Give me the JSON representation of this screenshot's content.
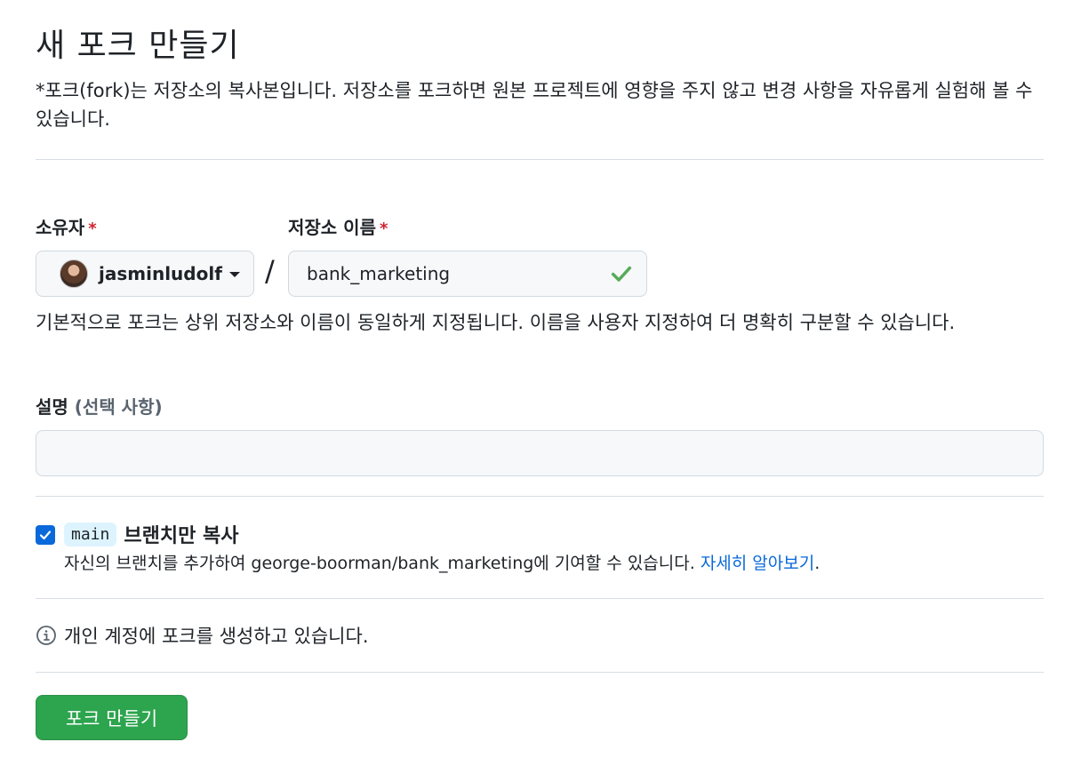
{
  "header": {
    "title": "새 포크 만들기",
    "subtitle": "*포크(fork)는 저장소의 복사본입니다. 저장소를 포크하면 원본 프로젝트에 영향을 주지 않고 변경 사항을 자유롭게 실험해 볼 수 있습니다."
  },
  "owner": {
    "label": "소유자",
    "required_mark": "*",
    "selected": "jasminludolf"
  },
  "separator": "/",
  "repo_name": {
    "label": "저장소 이름",
    "required_mark": "*",
    "value": "bank_marketing",
    "valid": true
  },
  "name_help": "기본적으로 포크는 상위 저장소와 이름이 동일하게 지정됩니다. 이름을 사용자 지정하여 더 명확히 구분할 수 있습니다.",
  "description": {
    "label": "설명",
    "optional_label": "(선택 사항)",
    "value": ""
  },
  "copy_branch": {
    "checked": true,
    "branch": "main",
    "label": "브랜치만 복사",
    "help_text": "자신의 브랜치를 추가하여 george-boorman/bank_marketing에 기여할 수 있습니다. ",
    "link_text": "자세히 알아보기",
    "link_suffix": "."
  },
  "info": {
    "icon": "info-icon",
    "text": "개인 계정에 포크를 생성하고 있습니다."
  },
  "submit": {
    "label": "포크 만들기"
  },
  "colors": {
    "primary_button": "#2da44e",
    "link": "#0969da",
    "required": "#cf222e",
    "valid_check": "#57ab5a"
  }
}
